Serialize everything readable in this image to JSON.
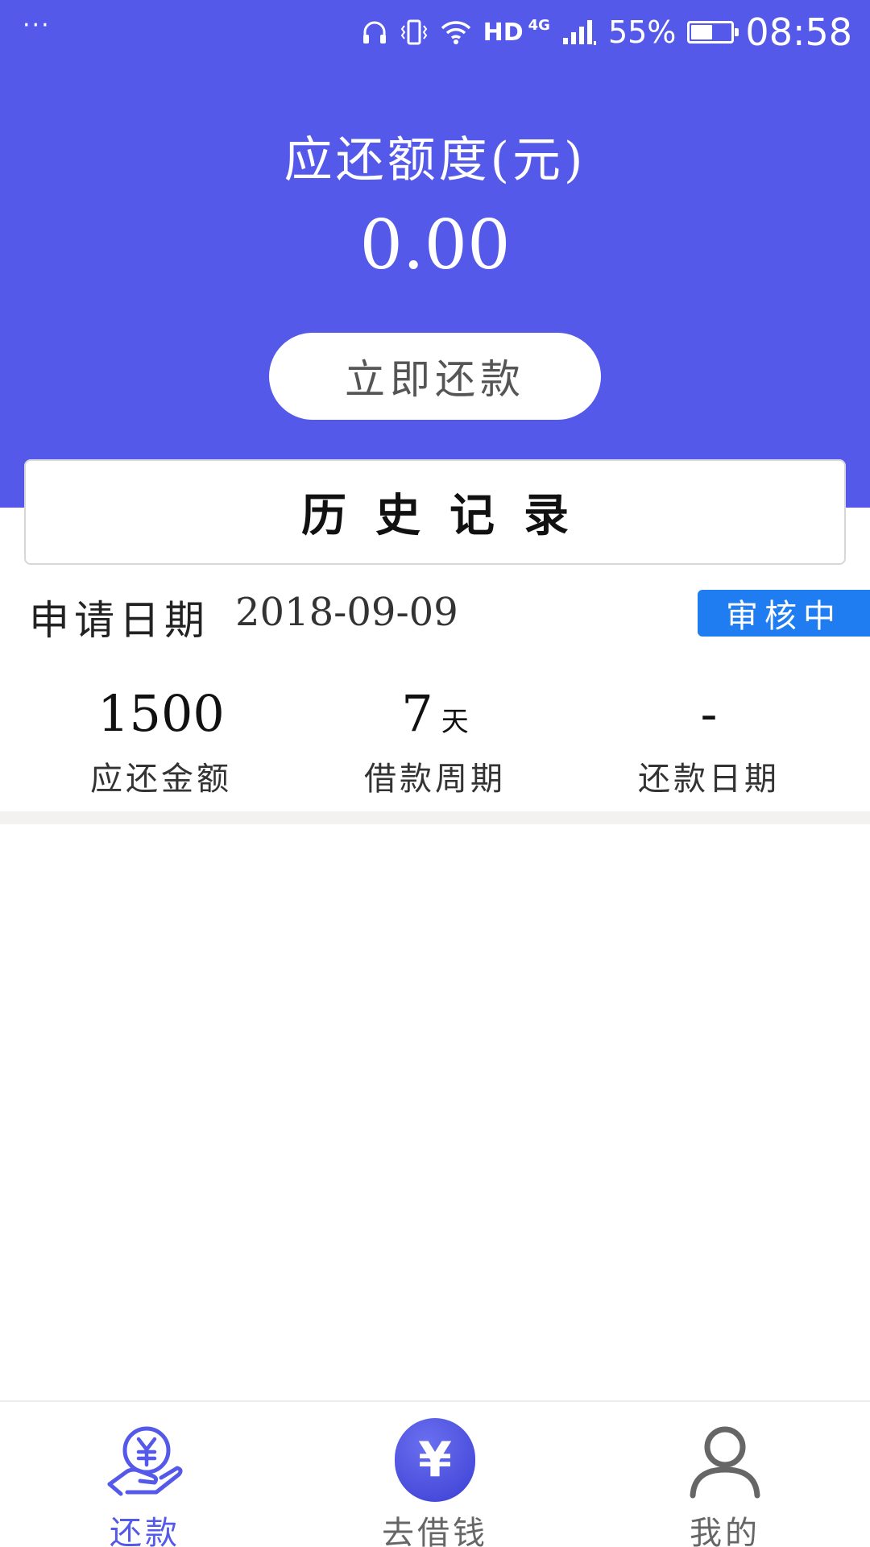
{
  "status_bar": {
    "menu_dots": "···",
    "hd": "HD",
    "network": "4G",
    "battery_percent": "55%",
    "battery_level": 0.55,
    "time": "08:58",
    "icons": [
      "headphones-icon",
      "vibrate-icon",
      "wifi-icon",
      "signal-icon",
      "battery-icon"
    ]
  },
  "header": {
    "due_label": "应还额度(元)",
    "due_amount": "0.00",
    "repay_button": "立即还款",
    "background_color": "#5459e9"
  },
  "history": {
    "title": "历史记录"
  },
  "record": {
    "apply_label": "申请日期",
    "apply_date": "2018-09-09",
    "status": "审核中",
    "status_color": "#1f7df1",
    "stats": [
      {
        "value": "1500",
        "unit": "",
        "label": "应还金额"
      },
      {
        "value": "7",
        "unit": "天",
        "label": "借款周期"
      },
      {
        "value": "-",
        "unit": "",
        "label": "还款日期"
      }
    ]
  },
  "tab_bar": {
    "tabs": [
      {
        "label": "还款",
        "icon": "hand-yuan-icon",
        "active": true
      },
      {
        "label": "去借钱",
        "icon": "yuan-circle-icon",
        "glyph": "¥",
        "active": false
      },
      {
        "label": "我的",
        "icon": "user-icon",
        "active": false
      }
    ],
    "active_color": "#5459e9"
  }
}
